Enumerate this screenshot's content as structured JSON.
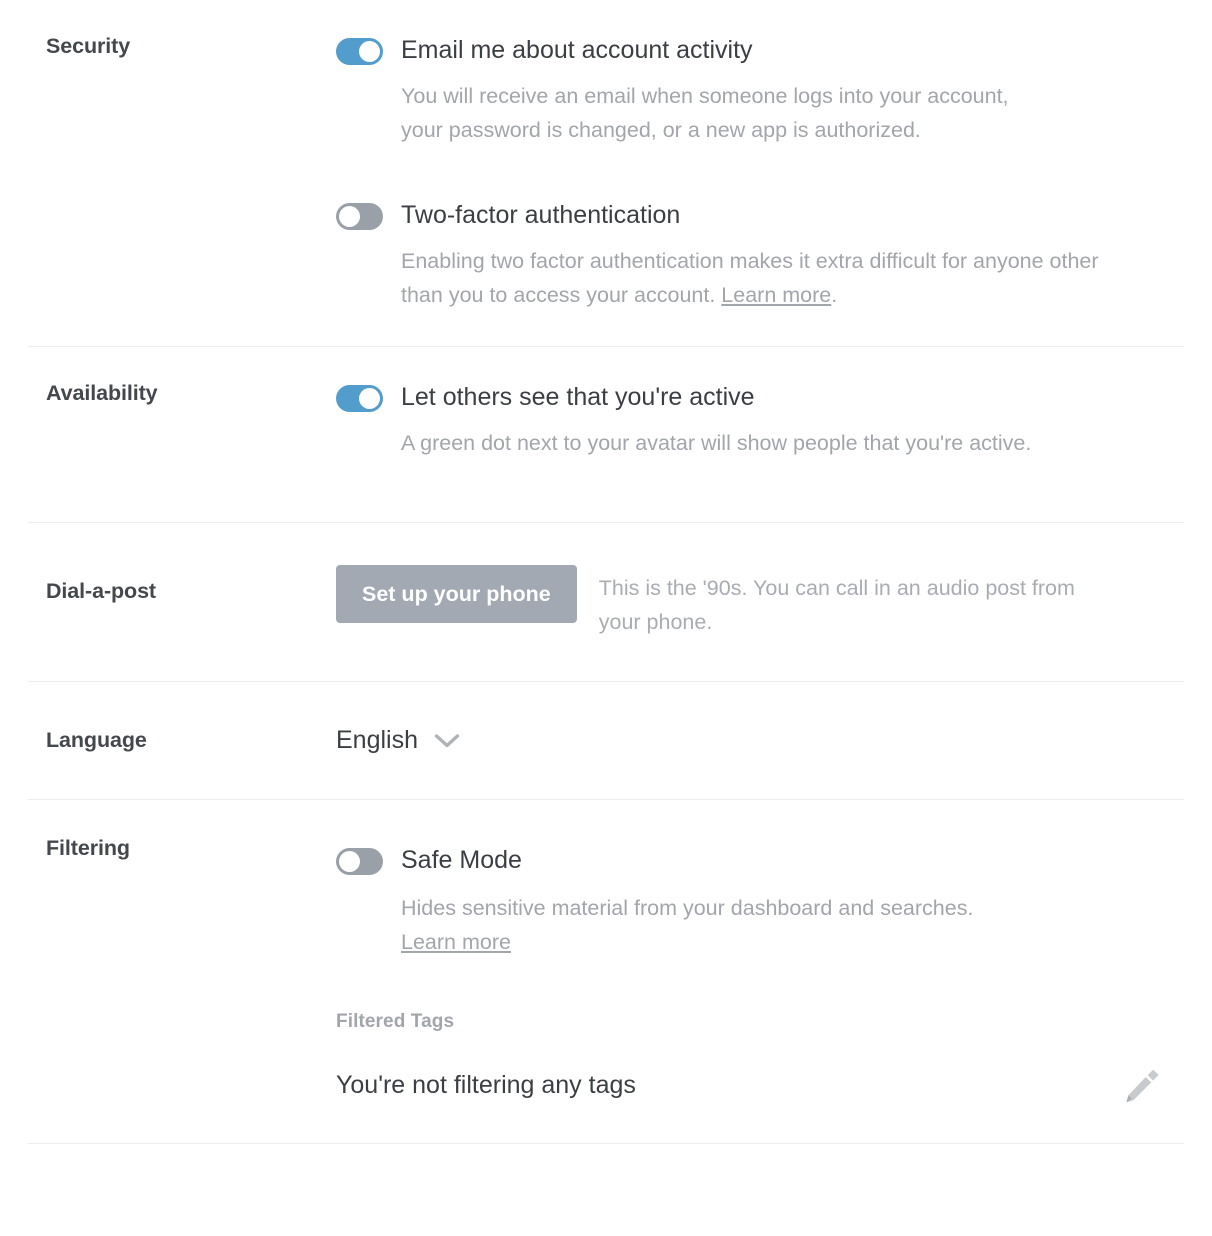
{
  "sections": {
    "security": {
      "label": "Security",
      "items": [
        {
          "toggle_state": "on",
          "label": "Email me about account activity",
          "description": "You will receive an email when someone logs into your account, your password is changed, or a new app is authorized."
        },
        {
          "toggle_state": "off",
          "label": "Two-factor authentication",
          "description_pre": "Enabling two factor authentication makes it extra difficult for anyone other than you to access your account. ",
          "link_text": "Learn more",
          "description_post": "."
        }
      ]
    },
    "availability": {
      "label": "Availability",
      "toggle_state": "on",
      "item_label": "Let others see that you're active",
      "description": "A green dot next to your avatar will show people that you're active."
    },
    "dial_a_post": {
      "label": "Dial-a-post",
      "button_label": "Set up your phone",
      "description": "This is the '90s. You can call in an audio post from your phone."
    },
    "language": {
      "label": "Language",
      "value": "English",
      "chevron_icon": "chevron-down-icon"
    },
    "filtering": {
      "label": "Filtering",
      "toggle_state": "off",
      "item_label": "Safe Mode",
      "description": "Hides sensitive material from your dashboard and searches.",
      "link_text": "Learn more",
      "filtered_tags_label": "Filtered Tags",
      "filtered_tags_value": "You're not filtering any tags",
      "edit_icon": "pencil-icon"
    }
  },
  "colors": {
    "toggle_on": "#539dcc",
    "toggle_off": "#9aa0a8",
    "button": "#a2a9b2",
    "heading_text": "#44484c",
    "body_text": "#3b3f43",
    "muted_text": "#a2a6ab",
    "divider": "#eaeced"
  }
}
